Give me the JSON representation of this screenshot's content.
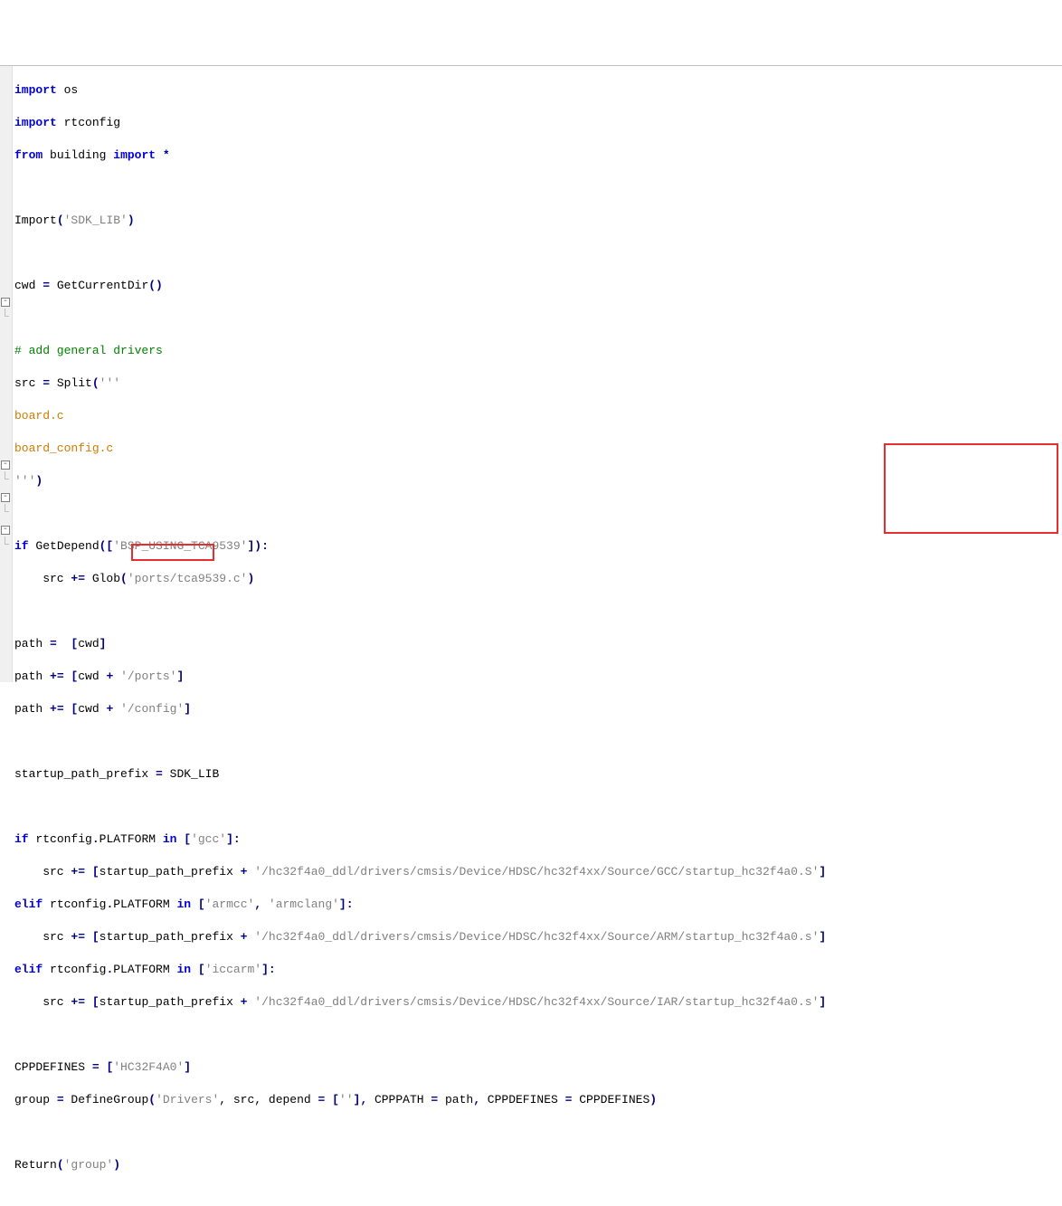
{
  "code": {
    "l1_import": "import",
    "l1_os": "os",
    "l2_import": "import",
    "l2_rt": "rtconfig",
    "l3_from": "from",
    "l3_building": "building",
    "l3_import": "import",
    "l3_star": "*",
    "l5_call": "Import",
    "l5_p1": "(",
    "l5_q": "'SDK_LIB'",
    "l5_p2": ")",
    "l7_cwd": "cwd ",
    "l7_eq": "=",
    "l7_call": " GetCurrentDir",
    "l7_p": "()",
    "l9_cmt": "# add general drivers",
    "l10_src": "src ",
    "l10_eq": "=",
    "l10_call": " Split",
    "l10_p1": "(",
    "l10_q": "'''",
    "l11": "board.c",
    "l12": "board_config.c",
    "l13_q": "'''",
    "l13_p2": ")",
    "l15_if": "if",
    "l15_call": " GetDepend",
    "l15_p1": "([",
    "l15_str": "'BSP_USING_TCA9539'",
    "l15_p2": "]):",
    "l16_src": "    src ",
    "l16_pe": "+=",
    "l16_call": " Glob",
    "l16_p1": "(",
    "l16_str": "'ports/tca9539.c'",
    "l16_p2": ")",
    "l18_path": "path ",
    "l18_eq": "=",
    "l18_bl": "  [",
    "l18_c": "cwd",
    "l18_br": "]",
    "l19_path": "path ",
    "l19_pe": "+=",
    "l19_bl": " [",
    "l19_c": "cwd ",
    "l19_plus": "+",
    "l19_str": " '/ports'",
    "l19_br": "]",
    "l20_path": "path ",
    "l20_pe": "+=",
    "l20_bl": " [",
    "l20_c": "cwd ",
    "l20_plus": "+",
    "l20_str": " '/config'",
    "l20_br": "]",
    "l22_spp": "startup_path_prefix ",
    "l22_eq": "=",
    "l22_sdk": " SDK_LIB",
    "l24_if": "if",
    "l24_r": " rtconfig",
    "l24_d": ".",
    "l24_P": "PLATFORM ",
    "l24_in": "in",
    "l24_bl": " [",
    "l24_str": "'gcc'",
    "l24_br": "]:",
    "l25_src": "    src ",
    "l25_pe": "+=",
    "l25_bl": " [",
    "l25_spp": "startup_path_prefix ",
    "l25_plus": "+",
    "l25_str": " '/hc32f4a0_ddl/drivers/cmsis/Device/HDSC/hc32f4xx/Source/GCC/startup_hc32f4a0.S'",
    "l25_br": "]",
    "l26_elif": "elif",
    "l26_r": " rtconfig",
    "l26_d": ".",
    "l26_P": "PLATFORM ",
    "l26_in": "in",
    "l26_bl": " [",
    "l26_s1": "'armcc'",
    "l26_c": ", ",
    "l26_s2": "'armclang'",
    "l26_br": "]:",
    "l27_src": "    src ",
    "l27_pe": "+=",
    "l27_bl": " [",
    "l27_spp": "startup_path_prefix ",
    "l27_plus": "+",
    "l27_str": " '/hc32f4a0_ddl/drivers/cmsis/Device/HDSC/hc32f4xx/Source/ARM/startup_hc32f4a0.s'",
    "l27_br": "]",
    "l28_elif": "elif",
    "l28_r": " rtconfig",
    "l28_d": ".",
    "l28_P": "PLATFORM ",
    "l28_in": "in",
    "l28_bl": " [",
    "l28_str": "'iccarm'",
    "l28_br": "]:",
    "l29_src": "    src ",
    "l29_pe": "+=",
    "l29_bl": " [",
    "l29_spp": "startup_path_prefix ",
    "l29_plus": "+",
    "l29_str": " '/hc32f4a0_ddl/drivers/cmsis/Device/HDSC/hc32f4xx/Source/IAR/startup_hc32f4a0.s'",
    "l29_br": "]",
    "l31_cpp": "CPPDEFINES ",
    "l31_eq": "=",
    "l31_bl": " [",
    "l31_str": "'HC32F4A0'",
    "l31_br": "]",
    "l32_grp": "group ",
    "l32_eq": "=",
    "l32_call": " DefineGroup",
    "l32_p1": "(",
    "l32_s1": "'Drivers'",
    "l32_mid": ", src, depend ",
    "l32_eq2": "=",
    "l32_bl2": " [",
    "l32_s2": "''",
    "l32_br2": "],",
    "l32_cpath": " CPPPATH ",
    "l32_eq3": "=",
    "l32_path": " path",
    "l32_c3": ",",
    "l32_cdef": " CPPDEFINES ",
    "l32_eq4": "=",
    "l32_cdef2": " CPPDEFINES",
    "l32_p2": ")",
    "l34_ret": "Return",
    "l34_p1": "(",
    "l34_str": "'group'",
    "l34_p2": ")"
  }
}
